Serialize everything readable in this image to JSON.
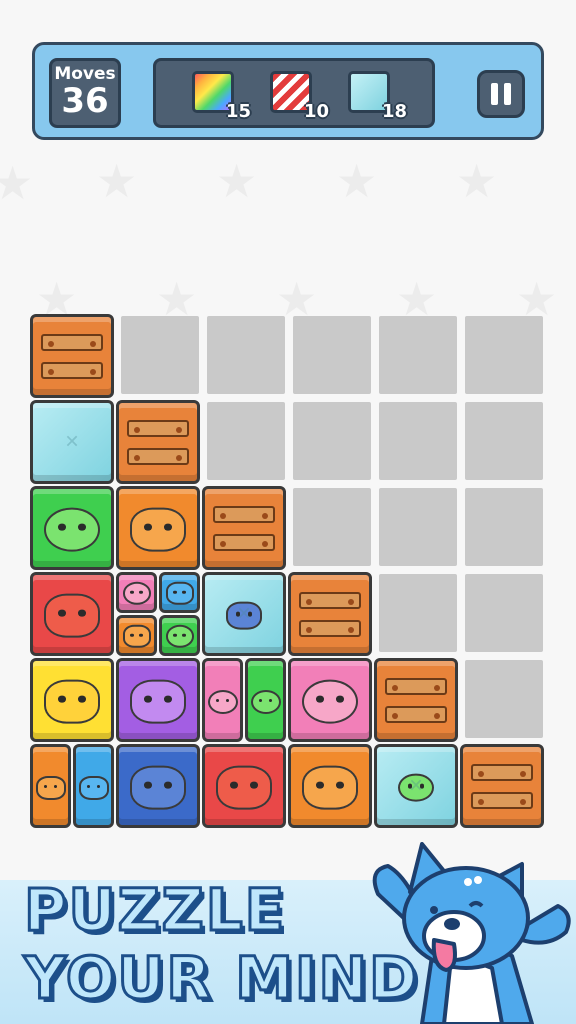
{
  "hud": {
    "moves_label": "Moves",
    "moves_value": "36",
    "goals": [
      {
        "icon": "rainbow-block-icon",
        "count": "15"
      },
      {
        "icon": "striped-block-icon",
        "count": "10"
      },
      {
        "icon": "ice-block-icon",
        "count": "18"
      }
    ],
    "pause_icon": "pause-icon"
  },
  "footer": {
    "line1": "PUZZLE",
    "line2": "YOUR MIND",
    "mascot": "shiba-dog-mascot"
  },
  "colors": {
    "hud_bg": "#87c8ee",
    "crate": "#e8833a",
    "green": "#3fcf4f",
    "orange": "#f18a2d",
    "red": "#e94848",
    "pink": "#f27fb8",
    "blue": "#40a9e8",
    "yellow": "#ffe033",
    "purple": "#a35ee3",
    "navy": "#3b6ac9"
  },
  "board": {
    "columns": 6,
    "rows": 6,
    "tiles": [
      {
        "kind": "crate",
        "col": 0,
        "row": 0
      },
      {
        "kind": "ice",
        "col": 0,
        "row": 1,
        "content": "frozen-animals"
      },
      {
        "kind": "crate",
        "col": 1,
        "row": 1
      },
      {
        "kind": "animal",
        "col": 0,
        "row": 2,
        "animal": "frog",
        "color": "green"
      },
      {
        "kind": "animal",
        "col": 1,
        "row": 2,
        "animal": "hamster",
        "color": "orange"
      },
      {
        "kind": "crate",
        "col": 2,
        "row": 2
      },
      {
        "kind": "animal",
        "col": 0,
        "row": 3,
        "animal": "red-panda",
        "color": "red"
      },
      {
        "kind": "quad",
        "col": 1,
        "row": 3,
        "parts": [
          {
            "animal": "pig",
            "color": "pink"
          },
          {
            "animal": "husky",
            "color": "blue"
          },
          {
            "animal": "hamster",
            "color": "orange"
          },
          {
            "animal": "frog",
            "color": "green"
          }
        ]
      },
      {
        "kind": "ice",
        "col": 2,
        "row": 3,
        "content": "penguin"
      },
      {
        "kind": "crate",
        "col": 3,
        "row": 3
      },
      {
        "kind": "animal",
        "col": 0,
        "row": 4,
        "animal": "cat",
        "color": "yellow"
      },
      {
        "kind": "animal",
        "col": 1,
        "row": 4,
        "animal": "chick",
        "color": "purple"
      },
      {
        "kind": "half",
        "col": 2,
        "row": 4,
        "parts": [
          {
            "animal": "pig",
            "color": "pink"
          },
          {
            "animal": "frog",
            "color": "green"
          }
        ]
      },
      {
        "kind": "animal",
        "col": 3,
        "row": 4,
        "animal": "pig",
        "color": "pink"
      },
      {
        "kind": "crate",
        "col": 4,
        "row": 4
      },
      {
        "kind": "half",
        "col": 0,
        "row": 5,
        "parts": [
          {
            "animal": "hamster",
            "color": "orange"
          },
          {
            "animal": "husky",
            "color": "blue"
          }
        ]
      },
      {
        "kind": "animal",
        "col": 1,
        "row": 5,
        "animal": "penguin",
        "color": "navy"
      },
      {
        "kind": "animal",
        "col": 2,
        "row": 5,
        "animal": "red-panda",
        "color": "red"
      },
      {
        "kind": "animal",
        "col": 3,
        "row": 5,
        "animal": "hamster",
        "color": "orange"
      },
      {
        "kind": "ice",
        "col": 4,
        "row": 5,
        "content": "frog"
      },
      {
        "kind": "crate",
        "col": 5,
        "row": 5
      }
    ]
  }
}
